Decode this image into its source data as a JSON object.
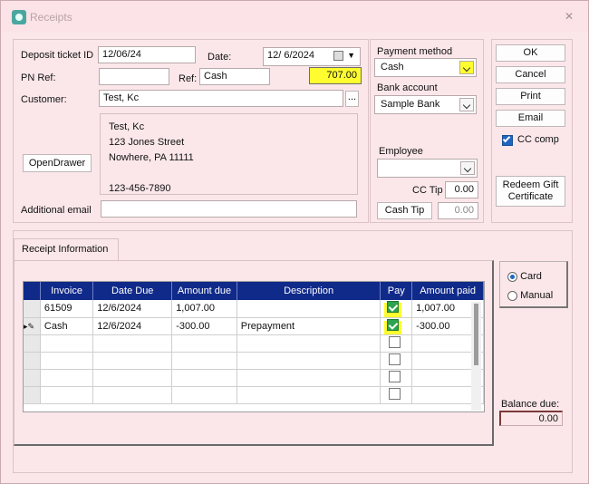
{
  "window": {
    "title": "Receipts"
  },
  "labels": {
    "deposit_ticket": "Deposit ticket ID",
    "date": "Date:",
    "pn_ref": "PN Ref:",
    "ref": "Ref:",
    "customer": "Customer:",
    "additional_email": "Additional email",
    "payment_method": "Payment method",
    "bank_account": "Bank account",
    "employee": "Employee",
    "cc_tip": "CC Tip",
    "balance_due": "Balance due:"
  },
  "fields": {
    "deposit_ticket_id": "12/06/24",
    "date": "12/ 6/2024",
    "pn_ref": "",
    "ref": "Cash",
    "amount": "707.00",
    "customer": "Test, Kc",
    "customer_lookup": "...",
    "address_lines": [
      "Test, Kc",
      "123 Jones Street",
      "Nowhere,  PA 11111",
      "",
      "123-456-7890"
    ],
    "additional_email": "",
    "payment_method": "Cash",
    "bank_account": "Sample Bank",
    "employee": "",
    "cc_tip": "0.00",
    "cash_tip_value": "0.00",
    "balance_due": "0.00"
  },
  "buttons": {
    "ok": "OK",
    "cancel": "Cancel",
    "print": "Print",
    "email": "Email",
    "cc_comp": "CC comp",
    "redeem": "Redeem Gift Certificate",
    "open_drawer": "OpenDrawer",
    "cash_tip": "Cash Tip"
  },
  "tab": {
    "label": "Receipt Information"
  },
  "table": {
    "columns": [
      "Invoice",
      "Date Due",
      "Amount due",
      "Description",
      "Pay",
      "Amount paid"
    ],
    "rows": [
      {
        "invoice": "61509",
        "date_due": "12/6/2024",
        "amount_due": "1,007.00",
        "description": "",
        "pay": true,
        "amount_paid": "1,007.00"
      },
      {
        "invoice": "Cash",
        "date_due": "12/6/2024",
        "amount_due": "-300.00",
        "description": "Prepayment",
        "pay": true,
        "amount_paid": "-300.00"
      }
    ]
  },
  "card_options": {
    "card": "Card",
    "manual": "Manual",
    "selected": "Card"
  },
  "colors": {
    "highlight": "#fffc2f",
    "grid_header": "#102a8a",
    "checkbox_on": "#2da44e"
  }
}
